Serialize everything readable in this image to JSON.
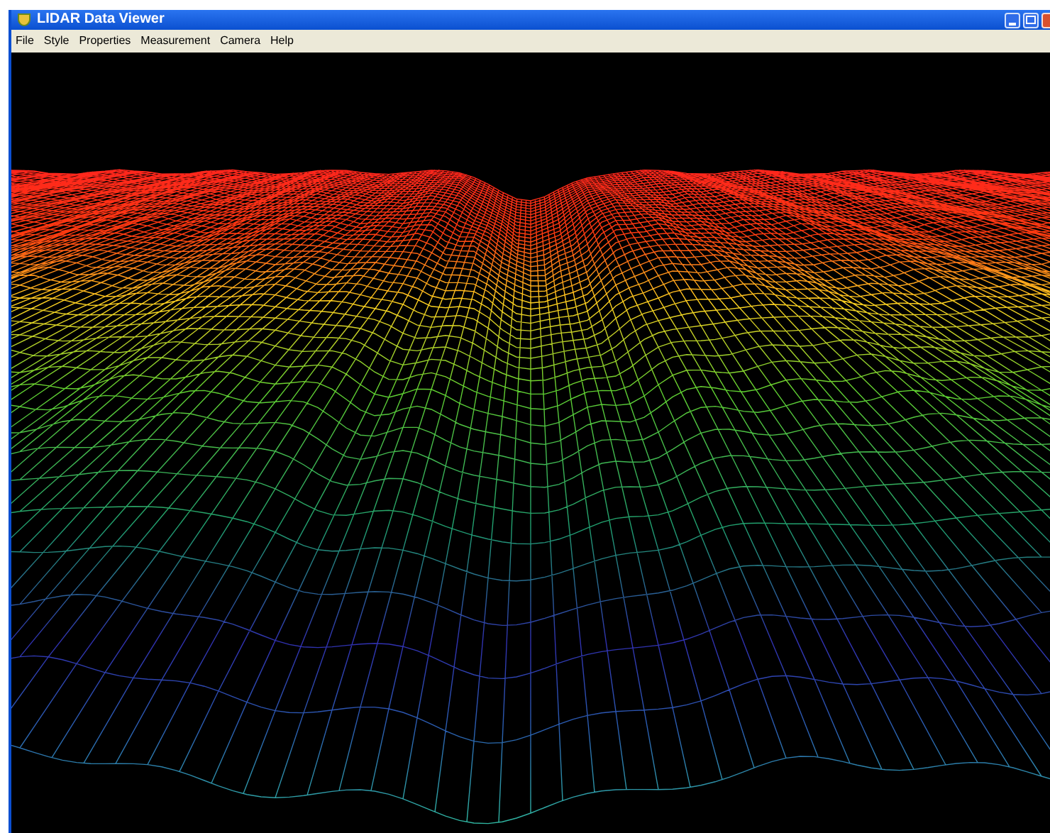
{
  "window": {
    "title": "LIDAR Data Viewer"
  },
  "menu": [
    "File",
    "Style",
    "Properties",
    "Measurement",
    "Camera",
    "Help"
  ]
}
